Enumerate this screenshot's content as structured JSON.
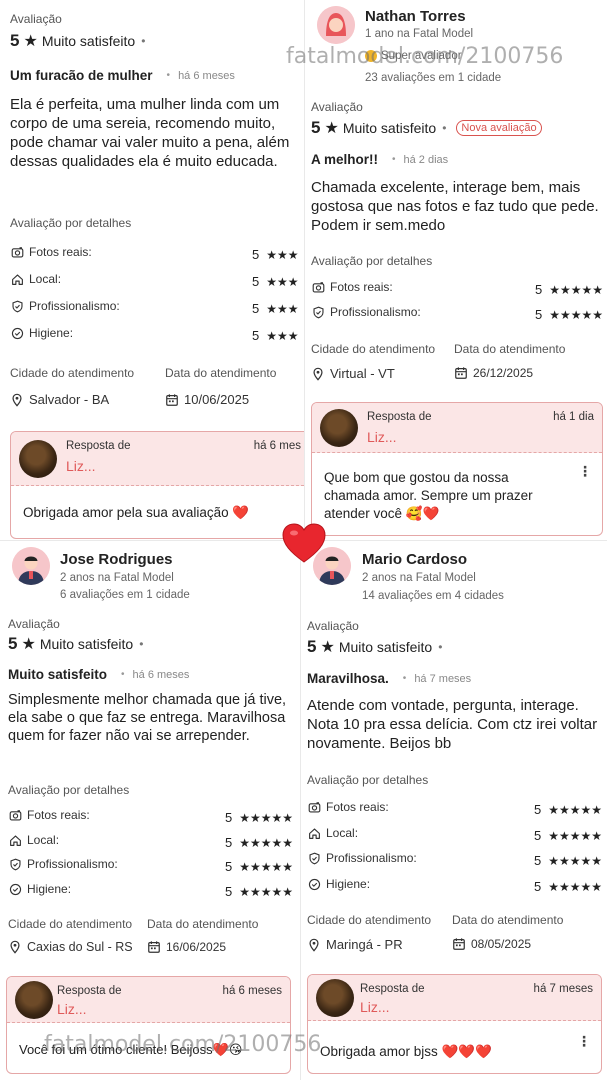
{
  "common": {
    "eval_label": "Avaliação",
    "satisfaction": "Muito satisfeito",
    "details_label": "Avaliação por detalhes",
    "city_label": "Cidade do atendimento",
    "date_label": "Data do atendimento",
    "response_label": "Resposta de",
    "responder": "Liz...",
    "criteria": {
      "photos": "Fotos reais:",
      "local": "Local:",
      "pro": "Profissionalismo:",
      "hygiene": "Higiene:"
    },
    "accent_color": "#e05a5a"
  },
  "p1": {
    "score": "5",
    "title": "Um furacão de mulher",
    "ago": "há 6 meses",
    "body": "Ela é perfeita, uma mulher linda com um corpo de uma sereia, recomendo muito, pode chamar vai valer muito a pena, além dessas qualidades ela é muito educada.",
    "details": [
      {
        "key": "photos",
        "score": "5",
        "stars": "★★★"
      },
      {
        "key": "local",
        "score": "5",
        "stars": "★★★"
      },
      {
        "key": "pro",
        "score": "5",
        "stars": "★★★"
      },
      {
        "key": "hygiene",
        "score": "5",
        "stars": "★★★"
      }
    ],
    "city": "Salvador - BA",
    "date": "10/06/2025",
    "resp_ago": "há 6 mes",
    "resp_msg": "Obrigada amor pela sua avaliação ❤️"
  },
  "p2": {
    "user": "Nathan Torres",
    "user_since": "1 ano na Fatal Model",
    "user_badge": "Super avaliador",
    "user_count": "23 avaliações em 1 cidade",
    "score": "5",
    "new_badge": "Nova avaliação",
    "title": "A melhor!!",
    "ago": "há 2 dias",
    "body": "Chamada excelente, interage bem, mais gostosa que nas fotos e faz tudo que pede. Podem ir sem.medo",
    "details": [
      {
        "key": "photos",
        "score": "5",
        "stars": "★★★★★"
      },
      {
        "key": "pro",
        "score": "5",
        "stars": "★★★★★"
      }
    ],
    "city": "Virtual - VT",
    "date": "26/12/2025",
    "resp_ago": "há 1 dia",
    "resp_msg": "Que bom que gostou da nossa chamada amor. Sempre um prazer atender você 🥰❤️"
  },
  "p3": {
    "user": "Jose Rodrigues",
    "user_since": "2 anos na Fatal Model",
    "user_count": "6 avaliações em 1 cidade",
    "score": "5",
    "title": "Muito satisfeito",
    "ago": "há 6 meses",
    "body": "Simplesmente melhor chamada que já tive, ela sabe o que faz se entrega. Maravilhosa quem for fazer não vai se arrepender.",
    "details": [
      {
        "key": "photos",
        "score": "5",
        "stars": "★★★★★"
      },
      {
        "key": "local",
        "score": "5",
        "stars": "★★★★★"
      },
      {
        "key": "pro",
        "score": "5",
        "stars": "★★★★★"
      },
      {
        "key": "hygiene",
        "score": "5",
        "stars": "★★★★★"
      }
    ],
    "city": "Caxias do Sul - RS",
    "date": "16/06/2025",
    "resp_ago": "há 6 meses",
    "resp_msg": "Você foi um ótimo cliente! Beijoss❤️😘"
  },
  "p4": {
    "user": "Mario Cardoso",
    "user_since": "2 anos na Fatal Model",
    "user_count": "14 avaliações em 4 cidades",
    "score": "5",
    "title": "Maravilhosa.",
    "ago": "há 7 meses",
    "body": "Atende com vontade, pergunta, interage. Nota 10 pra essa delícia. Com ctz irei voltar novamente. Beijos bb",
    "details": [
      {
        "key": "photos",
        "score": "5",
        "stars": "★★★★★"
      },
      {
        "key": "local",
        "score": "5",
        "stars": "★★★★★"
      },
      {
        "key": "pro",
        "score": "5",
        "stars": "★★★★★"
      },
      {
        "key": "hygiene",
        "score": "5",
        "stars": "★★★★★"
      }
    ],
    "city": "Maringá - PR",
    "date": "08/05/2025",
    "resp_ago": "há 7 meses",
    "resp_msg": "Obrigada amor bjss ❤️❤️❤️"
  },
  "watermark": "fatalmodel.com/2100756"
}
